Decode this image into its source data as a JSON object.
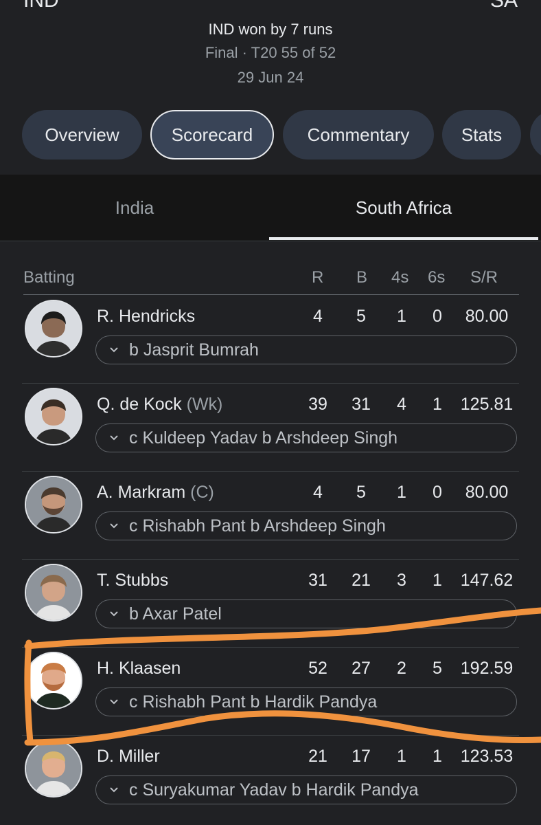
{
  "match": {
    "team_left": "IND",
    "team_right": "SA",
    "result": "IND won by 7 runs",
    "status": "Final · T20 55 of 52",
    "date": "29 Jun 24"
  },
  "nav_chips": [
    "Overview",
    "Scorecard",
    "Commentary",
    "Stats"
  ],
  "active_chip": "Scorecard",
  "team_tabs": {
    "india": "India",
    "south_africa": "South Africa",
    "selected": "South Africa"
  },
  "batting": {
    "header": {
      "title": "Batting",
      "runs": "R",
      "balls": "B",
      "fours": "4s",
      "sixes": "6s",
      "sr": "S/R"
    },
    "rows": [
      {
        "name": "R. Hendricks",
        "tag": "",
        "r": "4",
        "b": "5",
        "fours": "1",
        "sixes": "0",
        "sr": "80.00",
        "dismissal": "b Jasprit Bumrah"
      },
      {
        "name": "Q. de Kock",
        "tag": "(Wk)",
        "r": "39",
        "b": "31",
        "fours": "4",
        "sixes": "1",
        "sr": "125.81",
        "dismissal": "c Kuldeep Yadav b Arshdeep Singh"
      },
      {
        "name": "A. Markram",
        "tag": "(C)",
        "r": "4",
        "b": "5",
        "fours": "1",
        "sixes": "0",
        "sr": "80.00",
        "dismissal": "c Rishabh Pant b Arshdeep Singh"
      },
      {
        "name": "T. Stubbs",
        "tag": "",
        "r": "31",
        "b": "21",
        "fours": "3",
        "sixes": "1",
        "sr": "147.62",
        "dismissal": "b Axar Patel"
      },
      {
        "name": "H. Klaasen",
        "tag": "",
        "r": "52",
        "b": "27",
        "fours": "2",
        "sixes": "5",
        "sr": "192.59",
        "dismissal": "c Rishabh Pant b Hardik Pandya"
      },
      {
        "name": "D. Miller",
        "tag": "",
        "r": "21",
        "b": "17",
        "fours": "1",
        "sixes": "1",
        "sr": "123.53",
        "dismissal": "c Suryakumar Yadav b Hardik Pandya"
      }
    ]
  },
  "colors": {
    "background": "#202124",
    "chip": "#303846",
    "tab_bar": "#151515",
    "highlight": "#f0923e"
  }
}
